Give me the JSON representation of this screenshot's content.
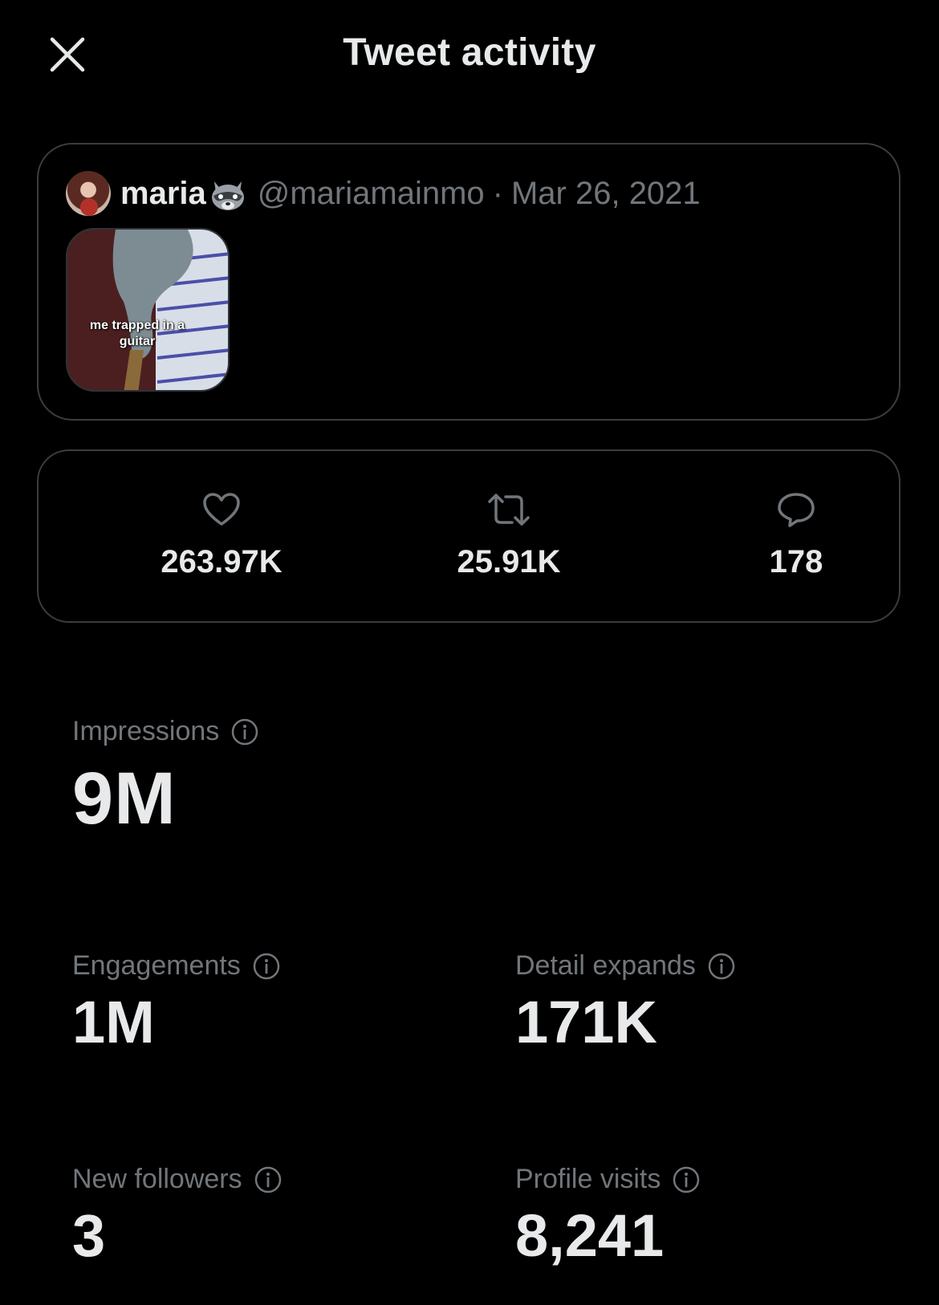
{
  "header": {
    "title": "Tweet activity",
    "close_icon": "close-icon"
  },
  "tweet": {
    "display_name": "maria",
    "name_emoji": "raccoon-icon",
    "handle": "@mariamainmo",
    "separator": "·",
    "date": "Mar 26, 2021",
    "media_caption": "me trapped in a guitar"
  },
  "stats": {
    "likes": {
      "icon": "heart-icon",
      "value": "263.97K"
    },
    "retweets": {
      "icon": "retweet-icon",
      "value": "25.91K"
    },
    "replies": {
      "icon": "reply-icon",
      "value": "178"
    }
  },
  "metrics": {
    "impressions": {
      "label": "Impressions",
      "value": "9M"
    },
    "engagements": {
      "label": "Engagements",
      "value": "1M"
    },
    "detail_expands": {
      "label": "Detail expands",
      "value": "171K"
    },
    "new_followers": {
      "label": "New followers",
      "value": "3"
    },
    "profile_visits": {
      "label": "Profile visits",
      "value": "8,241"
    }
  },
  "colors": {
    "background": "#000000",
    "primary_text": "#e7e9ea",
    "secondary_text": "#71767b",
    "border": "#3a3d40"
  }
}
